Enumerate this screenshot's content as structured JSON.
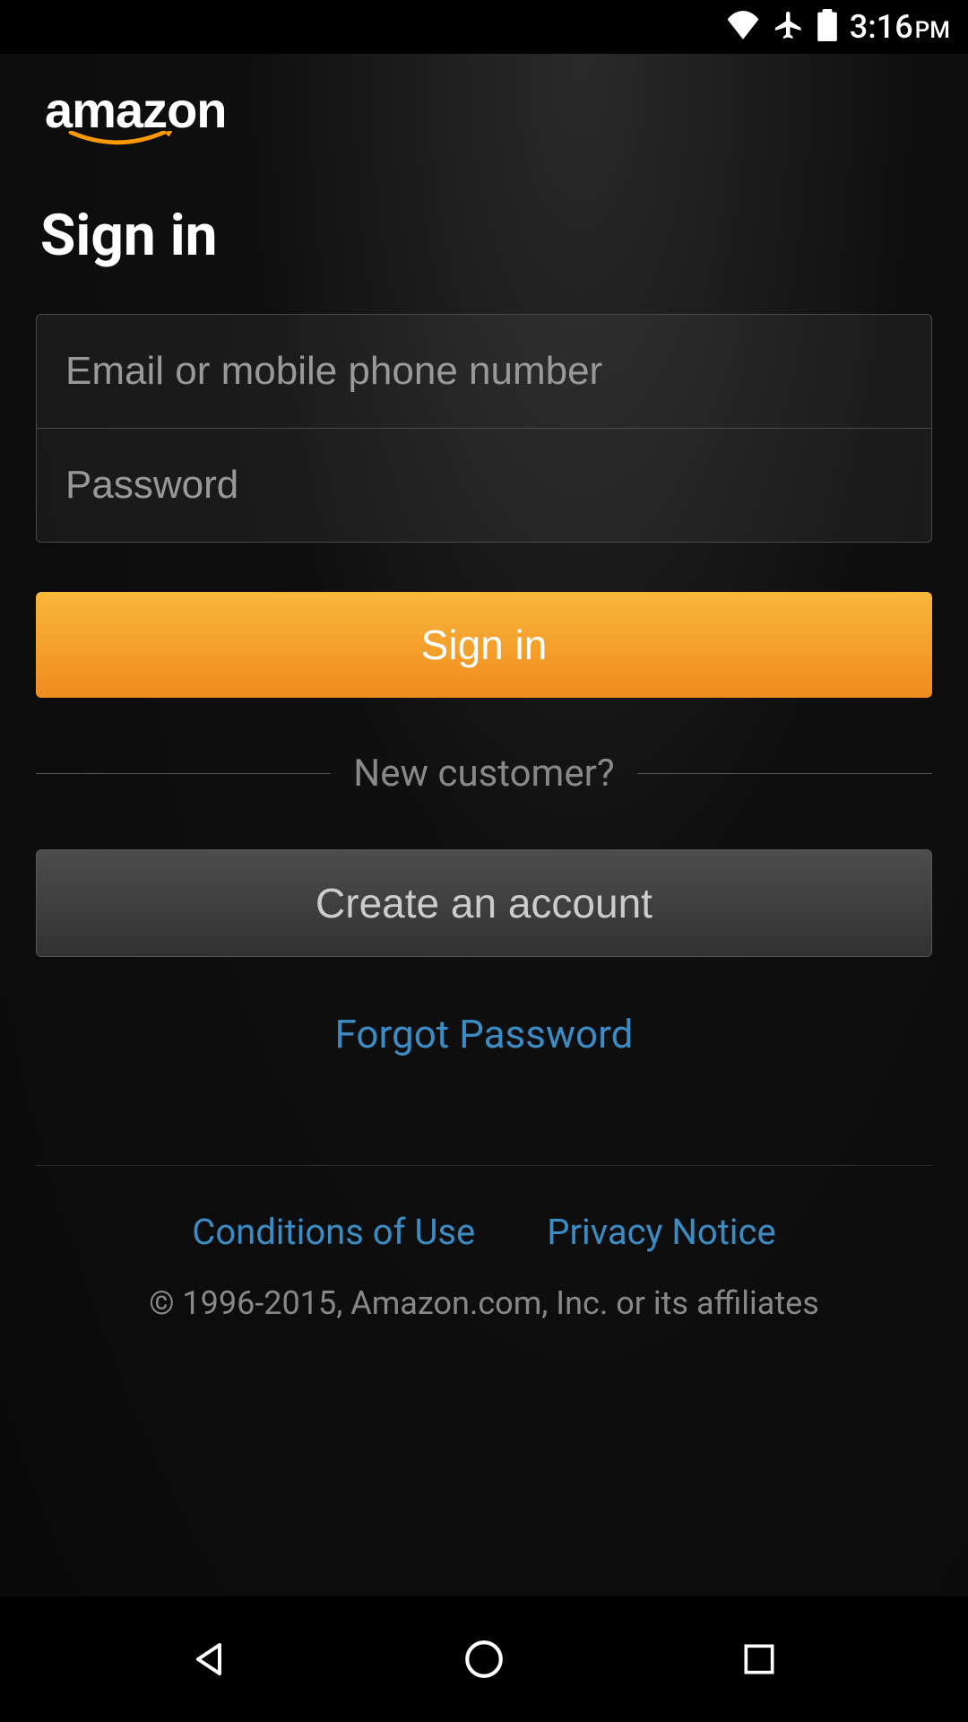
{
  "status_bar": {
    "time": "3:16",
    "time_period": "PM"
  },
  "logo": {
    "text": "amazon"
  },
  "header": {
    "title": "Sign in"
  },
  "form": {
    "email_placeholder": "Email or mobile phone number",
    "password_placeholder": "Password",
    "signin_label": "Sign in",
    "new_customer_label": "New customer?",
    "create_account_label": "Create an account",
    "forgot_password_label": "Forgot Password"
  },
  "footer": {
    "conditions_label": "Conditions of Use",
    "privacy_label": "Privacy Notice",
    "copyright": "© 1996-2015, Amazon.com, Inc. or its affiliates"
  }
}
